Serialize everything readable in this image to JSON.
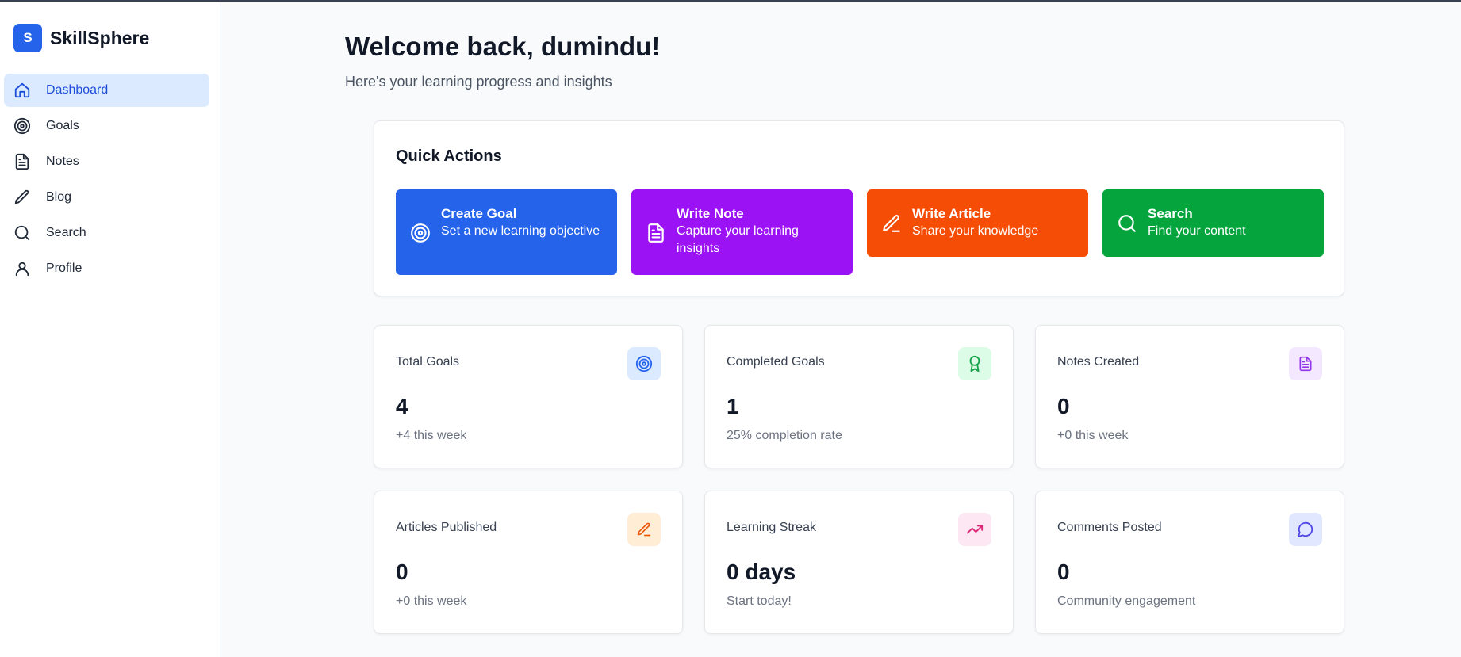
{
  "brand": {
    "logo_letter": "S",
    "name": "SkillSphere"
  },
  "sidebar": {
    "items": [
      {
        "label": "Dashboard",
        "icon": "home-icon",
        "active": true
      },
      {
        "label": "Goals",
        "icon": "target-icon",
        "active": false
      },
      {
        "label": "Notes",
        "icon": "file-text-icon",
        "active": false
      },
      {
        "label": "Blog",
        "icon": "pen-icon",
        "active": false
      },
      {
        "label": "Search",
        "icon": "search-icon",
        "active": false
      },
      {
        "label": "Profile",
        "icon": "user-icon",
        "active": false
      }
    ]
  },
  "header": {
    "title": "Welcome back, dumindu!",
    "subtitle": "Here's your learning progress and insights"
  },
  "quick_actions": {
    "title": "Quick Actions",
    "items": [
      {
        "title": "Create Goal",
        "subtitle": "Set a new learning objective",
        "icon": "target-icon",
        "color": "#2563eb"
      },
      {
        "title": "Write Note",
        "subtitle": "Capture your learning insights",
        "icon": "file-text-icon",
        "color": "#9b13f5"
      },
      {
        "title": "Write Article",
        "subtitle": "Share your knowledge",
        "icon": "pen-icon",
        "color": "#f54c06"
      },
      {
        "title": "Search",
        "subtitle": "Find your content",
        "icon": "search-icon",
        "color": "#06a43d"
      }
    ]
  },
  "stats": [
    {
      "label": "Total Goals",
      "value": "4",
      "sub": "+4 this week",
      "icon": "target-icon",
      "icon_color": "#2563eb",
      "icon_bg": "#dbeafe"
    },
    {
      "label": "Completed Goals",
      "value": "1",
      "sub": "25% completion rate",
      "icon": "award-icon",
      "icon_color": "#16a34a",
      "icon_bg": "#dcfce7"
    },
    {
      "label": "Notes Created",
      "value": "0",
      "sub": "+0 this week",
      "icon": "file-text-icon",
      "icon_color": "#9333ea",
      "icon_bg": "#f3e8ff"
    },
    {
      "label": "Articles Published",
      "value": "0",
      "sub": "+0 this week",
      "icon": "pen-icon",
      "icon_color": "#ea580c",
      "icon_bg": "#ffedd5"
    },
    {
      "label": "Learning Streak",
      "value": "0 days",
      "sub": "Start today!",
      "icon": "trending-up-icon",
      "icon_color": "#db2777",
      "icon_bg": "#fce7f3"
    },
    {
      "label": "Comments Posted",
      "value": "0",
      "sub": "Community engagement",
      "icon": "message-circle-icon",
      "icon_color": "#4f46e5",
      "icon_bg": "#e0e7ff"
    }
  ]
}
